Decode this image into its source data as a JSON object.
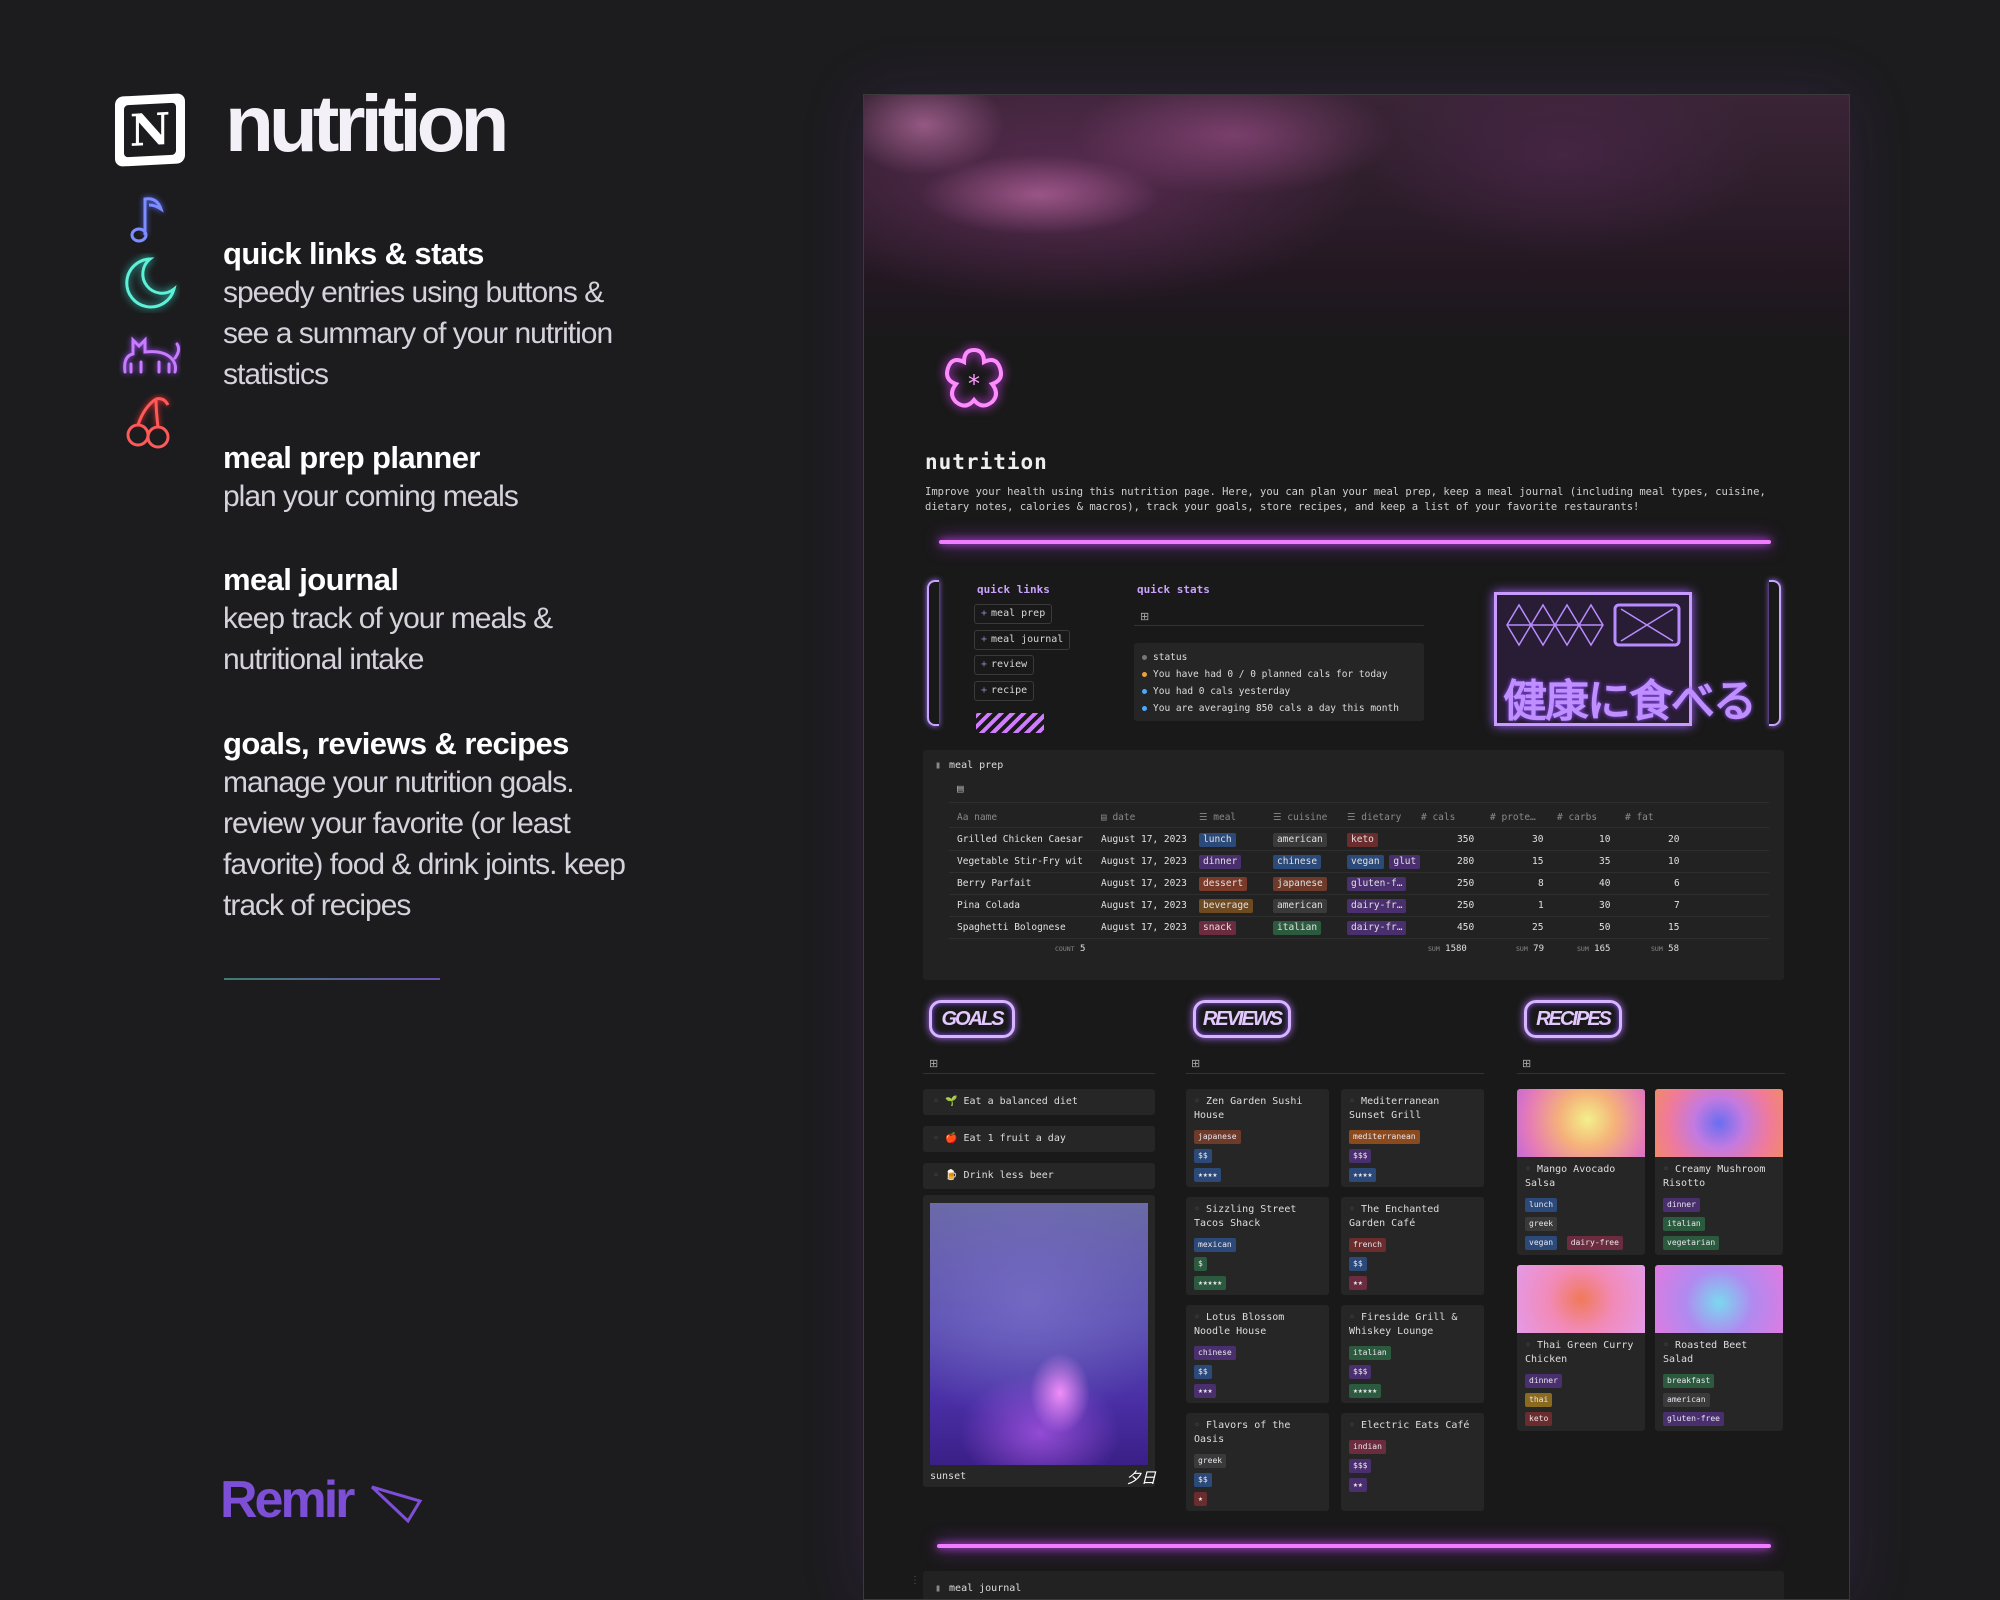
{
  "brand": {
    "notion_letter": "N",
    "title": "nutrition",
    "footer_logo": "Remir",
    "icons": [
      "music-note-icon",
      "crescent-moon-icon",
      "cat-icon",
      "cherries-icon"
    ]
  },
  "features": [
    {
      "heading": "quick links & stats",
      "text": "speedy entries using buttons & see a summary of your nutrition statistics"
    },
    {
      "heading": "meal prep planner",
      "text": "plan your coming meals"
    },
    {
      "heading": "meal journal",
      "text": "keep track of your meals & nutritional intake"
    },
    {
      "heading": "goals, reviews & recipes",
      "text": "manage your nutrition goals. review your favorite (or least favorite) food & drink joints. keep track of recipes"
    }
  ],
  "page": {
    "title": "nutrition",
    "description": "Improve your health using this nutrition page. Here, you can plan your meal prep, keep a meal journal (including meal types, cuisine, dietary notes, calories & macros), track your goals, store recipes, and keep a list of your favorite restaurants!",
    "quick_links": {
      "heading": "quick links",
      "buttons": [
        "meal prep",
        "meal journal",
        "review",
        "recipe"
      ]
    },
    "quick_stats": {
      "heading": "quick stats",
      "status_label": "status",
      "lines": [
        "You have had 0 / 0 planned cals for today",
        "You had 0 cals yesterday",
        "You are averaging 850 cals a day this month"
      ]
    },
    "jp_banner": "健康に食べる",
    "meal_prep": {
      "title": "meal prep",
      "columns": [
        "Aa name",
        "date",
        "meal",
        "cuisine",
        "dietary",
        "# cals",
        "# prote…",
        "# carbs",
        "# fat"
      ],
      "rows": [
        {
          "name": "Grilled Chicken Caesar",
          "date": "August 17, 2023",
          "meal": "lunch",
          "cuisine": "american",
          "dietary": "keto",
          "cals": "350",
          "protein": "30",
          "carbs": "10",
          "fat": "20"
        },
        {
          "name": "Vegetable Stir-Fry wit",
          "date": "August 17, 2023",
          "meal": "dinner",
          "cuisine": "chinese",
          "dietary": "vegan",
          "dietary2": "glut",
          "cals": "280",
          "protein": "15",
          "carbs": "35",
          "fat": "10"
        },
        {
          "name": "Berry Parfait",
          "date": "August 17, 2023",
          "meal": "dessert",
          "cuisine": "japanese",
          "dietary": "gluten-f…",
          "cals": "250",
          "protein": "8",
          "carbs": "40",
          "fat": "6"
        },
        {
          "name": "Pina Colada",
          "date": "August 17, 2023",
          "meal": "beverage",
          "cuisine": "american",
          "dietary": "dairy-fr…",
          "cals": "250",
          "protein": "1",
          "carbs": "30",
          "fat": "7"
        },
        {
          "name": "Spaghetti Bolognese",
          "date": "August 17, 2023",
          "meal": "snack",
          "cuisine": "italian",
          "dietary": "dairy-fr…",
          "cals": "450",
          "protein": "25",
          "carbs": "50",
          "fat": "15"
        }
      ],
      "footer": {
        "count_label": "COUNT",
        "count": "5",
        "sum_label": "SUM",
        "sum_cals": "1580",
        "sum_protein": "79",
        "sum_carbs": "165",
        "sum_fat": "58"
      }
    },
    "goals": {
      "label": "GOALS",
      "items": [
        "🌱 Eat a balanced diet",
        "🍎 Eat 1 fruit a day",
        "🍺 Drink less beer"
      ],
      "image_caption": "sunset",
      "image_caption_jp": "夕日"
    },
    "reviews": {
      "label": "REVIEWS",
      "items": [
        {
          "name": "Zen Garden Sushi House",
          "cuisine": "japanese",
          "price": "$$",
          "rating": "★★★★"
        },
        {
          "name": "Mediterranean Sunset Grill",
          "cuisine": "mediterranean",
          "price": "$$$",
          "rating": "★★★★"
        },
        {
          "name": "Sizzling Street Tacos Shack",
          "cuisine": "mexican",
          "price": "$",
          "rating": "★★★★★"
        },
        {
          "name": "The Enchanted Garden Café",
          "cuisine": "french",
          "price": "$$",
          "rating": "★★"
        },
        {
          "name": "Lotus Blossom Noodle House",
          "cuisine": "chinese",
          "price": "$$",
          "rating": "★★★"
        },
        {
          "name": "Fireside Grill & Whiskey Lounge",
          "cuisine": "italian",
          "price": "$$$",
          "rating": "★★★★★"
        },
        {
          "name": "Flavors of the Oasis",
          "cuisine": "greek",
          "price": "$$",
          "rating": "★"
        },
        {
          "name": "Electric Eats Café",
          "cuisine": "indian",
          "price": "$$$",
          "rating": "★★"
        }
      ]
    },
    "recipes": {
      "label": "RECIPES",
      "items": [
        {
          "name": "Mango Avocado Salsa",
          "tags": [
            "lunch",
            "greek",
            "vegan",
            "dairy-free"
          ]
        },
        {
          "name": "Creamy Mushroom Risotto",
          "tags": [
            "dinner",
            "italian",
            "vegetarian"
          ]
        },
        {
          "name": "Thai Green Curry Chicken",
          "tags": [
            "dinner",
            "thai",
            "keto"
          ]
        },
        {
          "name": "Roasted Beet Salad",
          "tags": [
            "breakfast",
            "american",
            "gluten-free"
          ]
        }
      ]
    },
    "meal_journal_title": "meal journal"
  },
  "colors": {
    "neon_pink": "#f07cff",
    "neon_violet": "#c99bff",
    "background": "#1c1c1e",
    "accent_purple": "#7d4fd6"
  }
}
